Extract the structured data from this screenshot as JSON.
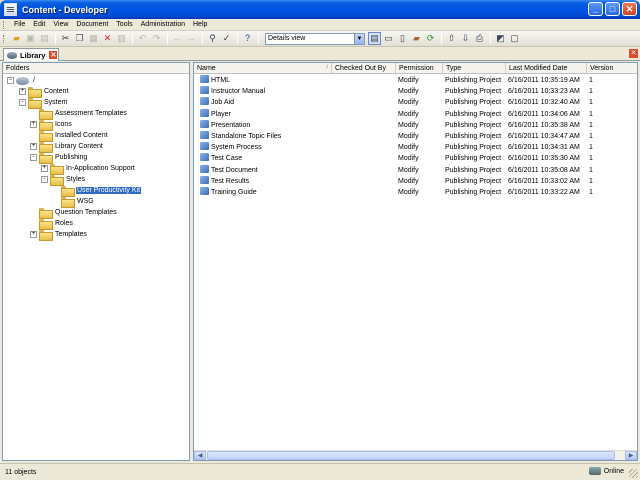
{
  "window": {
    "title": "Content - Developer"
  },
  "menu": [
    "File",
    "Edit",
    "View",
    "Document",
    "Tools",
    "Administration",
    "Help"
  ],
  "toolbar": {
    "view_select": "Details view",
    "icons": [
      "open-folder-icon",
      "save-icon",
      "print-icon",
      "cut-icon",
      "copy-icon",
      "paste-icon",
      "delete-icon",
      "properties-icon",
      "undo-icon",
      "redo-icon",
      "back-icon",
      "forward-icon",
      "find-icon",
      "spellcheck-icon",
      "help-icon"
    ],
    "view_icons": [
      "details-view-icon",
      "split-horizontal-icon",
      "split-vertical-icon",
      "sync-icon",
      "refresh-icon",
      "check-in-icon",
      "check-out-icon",
      "publish-icon",
      "preview-icon"
    ]
  },
  "tabs": {
    "active": "Library"
  },
  "folders": {
    "header": "Folders",
    "root": "/",
    "items": [
      {
        "label": "Content",
        "expander": "+"
      },
      {
        "label": "System",
        "expander": "-"
      },
      {
        "label": "Assessment Templates",
        "expander": ""
      },
      {
        "label": "Icons",
        "expander": "+"
      },
      {
        "label": "Installed Content",
        "expander": ""
      },
      {
        "label": "Library Content",
        "expander": "+"
      },
      {
        "label": "Publishing",
        "expander": "-"
      },
      {
        "label": "In-Application Support",
        "expander": "+"
      },
      {
        "label": "Styles",
        "expander": "-"
      },
      {
        "label": "User Productivity Kit",
        "expander": "",
        "selected": true
      },
      {
        "label": "WSG",
        "expander": ""
      },
      {
        "label": "Question Templates",
        "expander": ""
      },
      {
        "label": "Roles",
        "expander": ""
      },
      {
        "label": "Templates",
        "expander": "+"
      }
    ]
  },
  "list": {
    "columns": [
      "Name",
      "Checked Out By",
      "Permission",
      "Type",
      "Last Modified Date",
      "Version"
    ],
    "rows": [
      {
        "name": "HTML",
        "checked_out_by": "",
        "permission": "Modify",
        "type": "Publishing Project",
        "date": "6/16/2011 10:35:19 AM",
        "version": "1"
      },
      {
        "name": "Instructor Manual",
        "checked_out_by": "",
        "permission": "Modify",
        "type": "Publishing Project",
        "date": "6/16/2011 10:33:23 AM",
        "version": "1"
      },
      {
        "name": "Job Aid",
        "checked_out_by": "",
        "permission": "Modify",
        "type": "Publishing Project",
        "date": "6/16/2011 10:32:40 AM",
        "version": "1"
      },
      {
        "name": "Player",
        "checked_out_by": "",
        "permission": "Modify",
        "type": "Publishing Project",
        "date": "6/16/2011 10:34:06 AM",
        "version": "1"
      },
      {
        "name": "Presentation",
        "checked_out_by": "",
        "permission": "Modify",
        "type": "Publishing Project",
        "date": "6/16/2011 10:35:38 AM",
        "version": "1"
      },
      {
        "name": "Standalone Topic Files",
        "checked_out_by": "",
        "permission": "Modify",
        "type": "Publishing Project",
        "date": "6/16/2011 10:34:47 AM",
        "version": "1"
      },
      {
        "name": "System Process",
        "checked_out_by": "",
        "permission": "Modify",
        "type": "Publishing Project",
        "date": "6/16/2011 10:34:31 AM",
        "version": "1"
      },
      {
        "name": "Test Case",
        "checked_out_by": "",
        "permission": "Modify",
        "type": "Publishing Project",
        "date": "6/16/2011 10:35:30 AM",
        "version": "1"
      },
      {
        "name": "Test Document",
        "checked_out_by": "",
        "permission": "Modify",
        "type": "Publishing Project",
        "date": "6/16/2011 10:35:08 AM",
        "version": "1"
      },
      {
        "name": "Test Results",
        "checked_out_by": "",
        "permission": "Modify",
        "type": "Publishing Project",
        "date": "6/16/2011 10:33:02 AM",
        "version": "1"
      },
      {
        "name": "Training Guide",
        "checked_out_by": "",
        "permission": "Modify",
        "type": "Publishing Project",
        "date": "6/16/2011 10:33:22 AM",
        "version": "1"
      }
    ]
  },
  "status": {
    "count": "11 objects",
    "connection": "Online"
  },
  "colors": {
    "titlebar": "#0054E3",
    "selection": "#316AC5",
    "folder": "#F2C94C"
  }
}
